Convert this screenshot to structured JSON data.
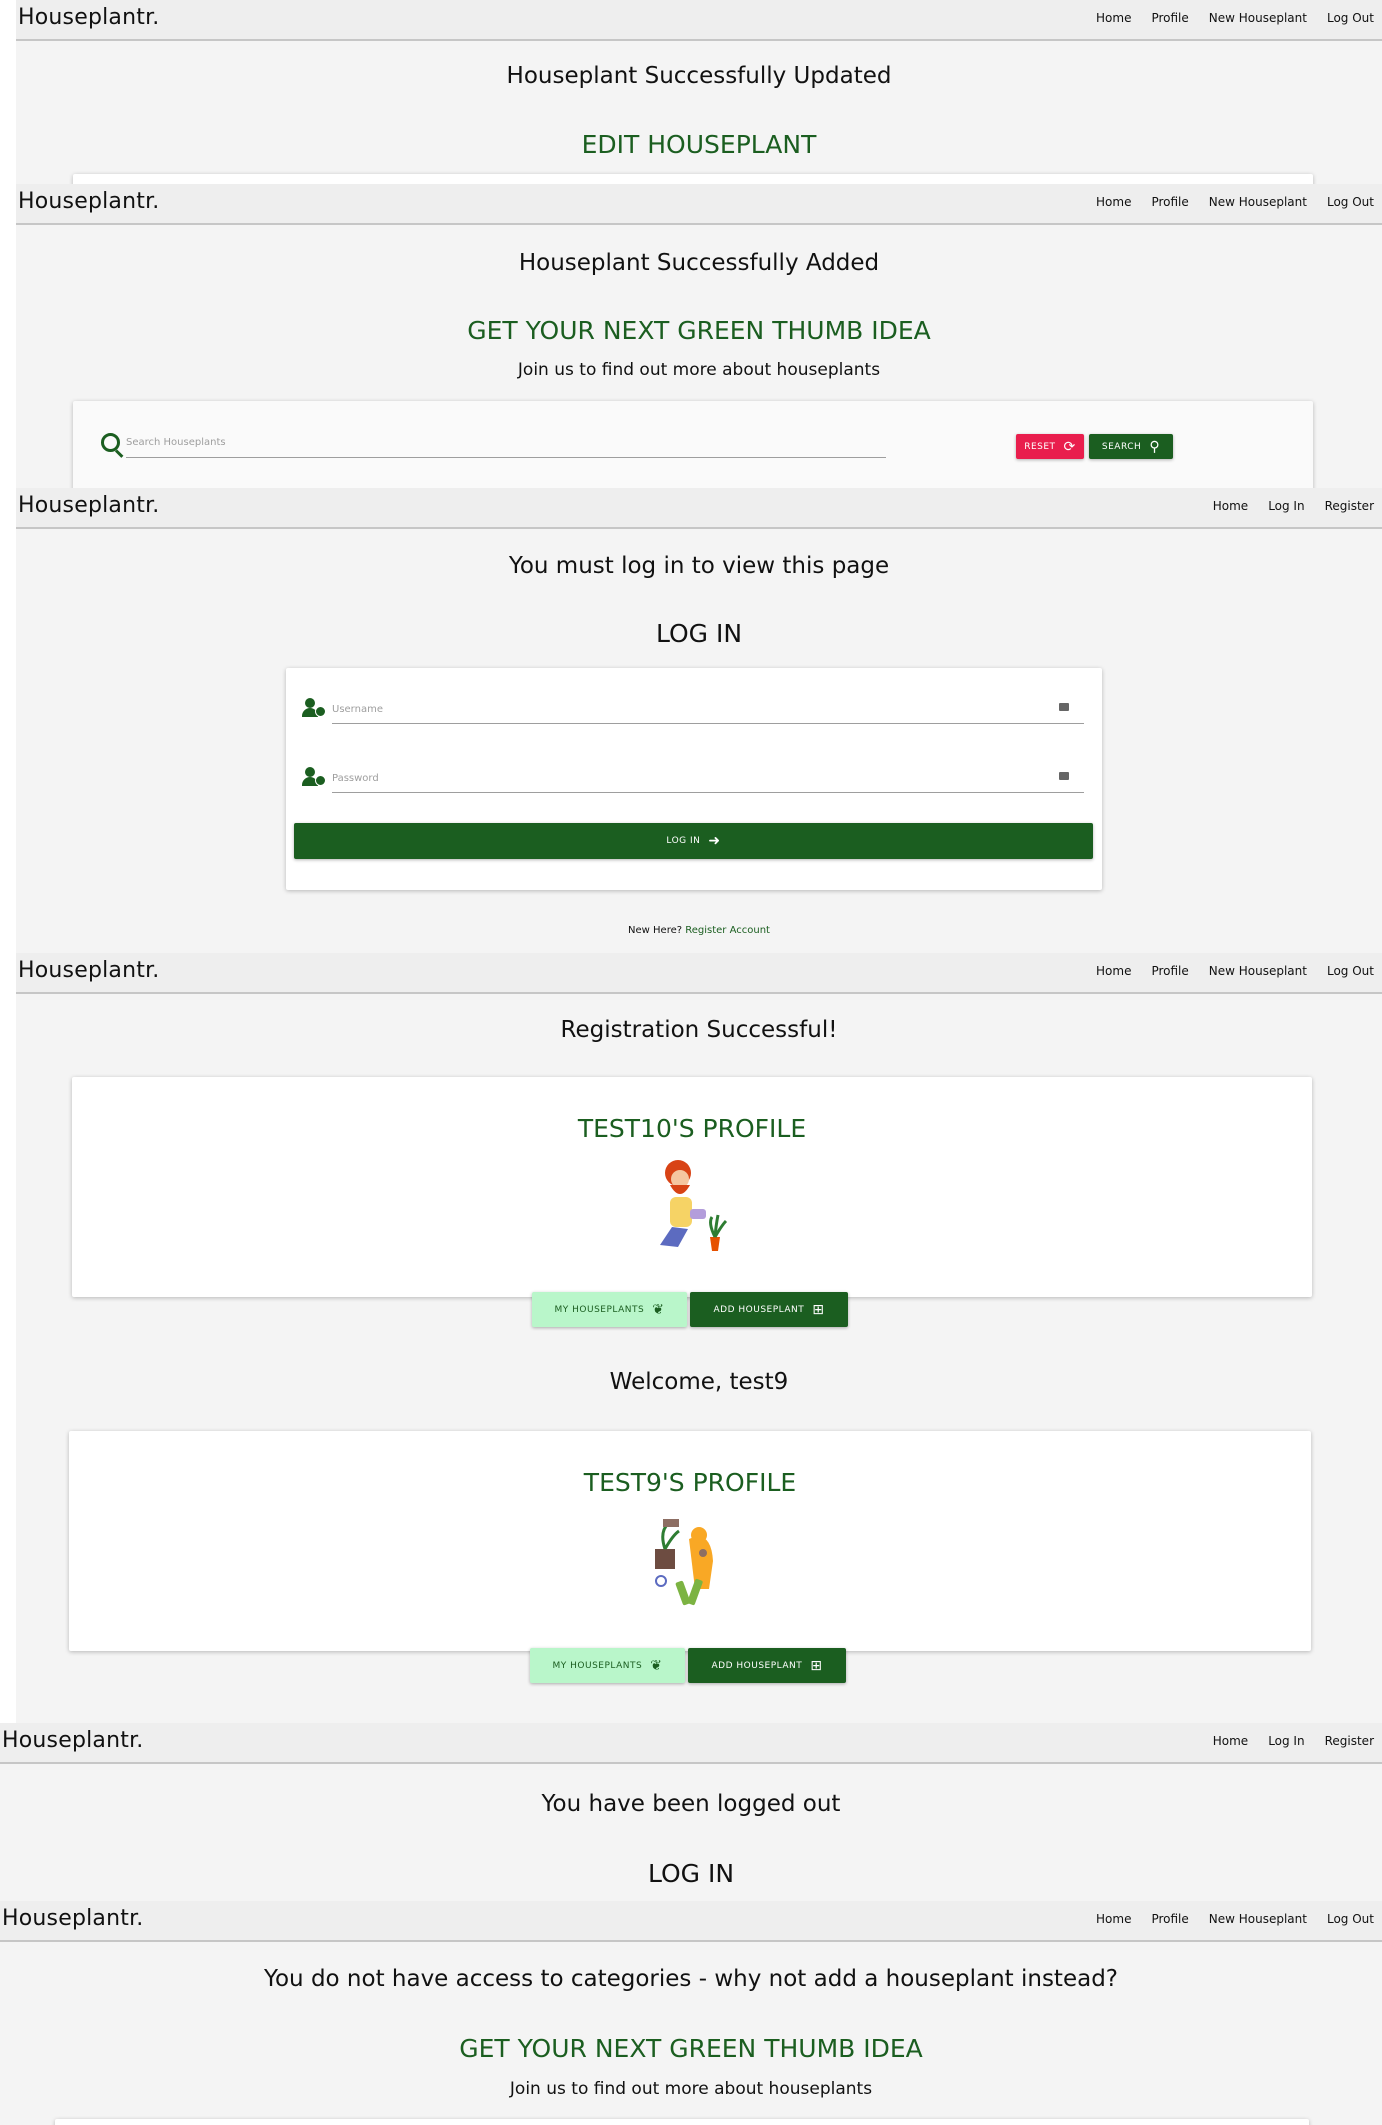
{
  "brand": "Houseplantr.",
  "nav_loggedin": {
    "home": "Home",
    "profile": "Profile",
    "new": "New Houseplant",
    "logout": "Log Out"
  },
  "nav_loggedout": {
    "home": "Home",
    "login": "Log In",
    "register": "Register"
  },
  "screens": {
    "edit": {
      "message": "Houseplant Successfully Updated",
      "heading": "EDIT HOUSEPLANT"
    },
    "added": {
      "message": "Houseplant Successfully Added",
      "heading": "GET YOUR NEXT GREEN THUMB IDEA",
      "sub": "Join us to find out more about houseplants",
      "search_placeholder": "Search Houseplants",
      "reset_label": "RESET",
      "search_label": "SEARCH"
    },
    "login": {
      "message": "You must log in to view this page",
      "heading": "LOG IN",
      "username_placeholder": "Username",
      "password_placeholder": "Password",
      "login_label": "LOG IN",
      "new_here": "New Here?",
      "register_link": "Register Account"
    },
    "registered": {
      "message": "Registration Successful!",
      "profile_title": "TEST10'S PROFILE",
      "my_houseplants": "MY HOUSEPLANTS",
      "add_houseplant": "ADD HOUSEPLANT"
    },
    "welcome": {
      "message": "Welcome, test9",
      "profile_title": "TEST9'S PROFILE",
      "my_houseplants": "MY HOUSEPLANTS",
      "add_houseplant": "ADD HOUSEPLANT"
    },
    "loggedout": {
      "message": "You have been logged out",
      "heading": "LOG IN"
    },
    "categories": {
      "message": "You do not have access to categories - why not add a houseplant instead?",
      "heading": "GET YOUR NEXT GREEN THUMB IDEA",
      "sub": "Join us to find out more about houseplants"
    }
  },
  "colors": {
    "brand_green": "#1b5e20",
    "reset_red": "#e91e4d",
    "light_green": "#b9f6ca",
    "nav_grey": "#eeeeee"
  },
  "icons": {
    "search": "search-icon",
    "reset": "refresh-icon",
    "login": "sign-in-icon",
    "leaf": "leaf-icon",
    "plus": "plus-square-icon",
    "user_cog": "user-cog-icon",
    "user_lock": "user-lock-icon"
  }
}
